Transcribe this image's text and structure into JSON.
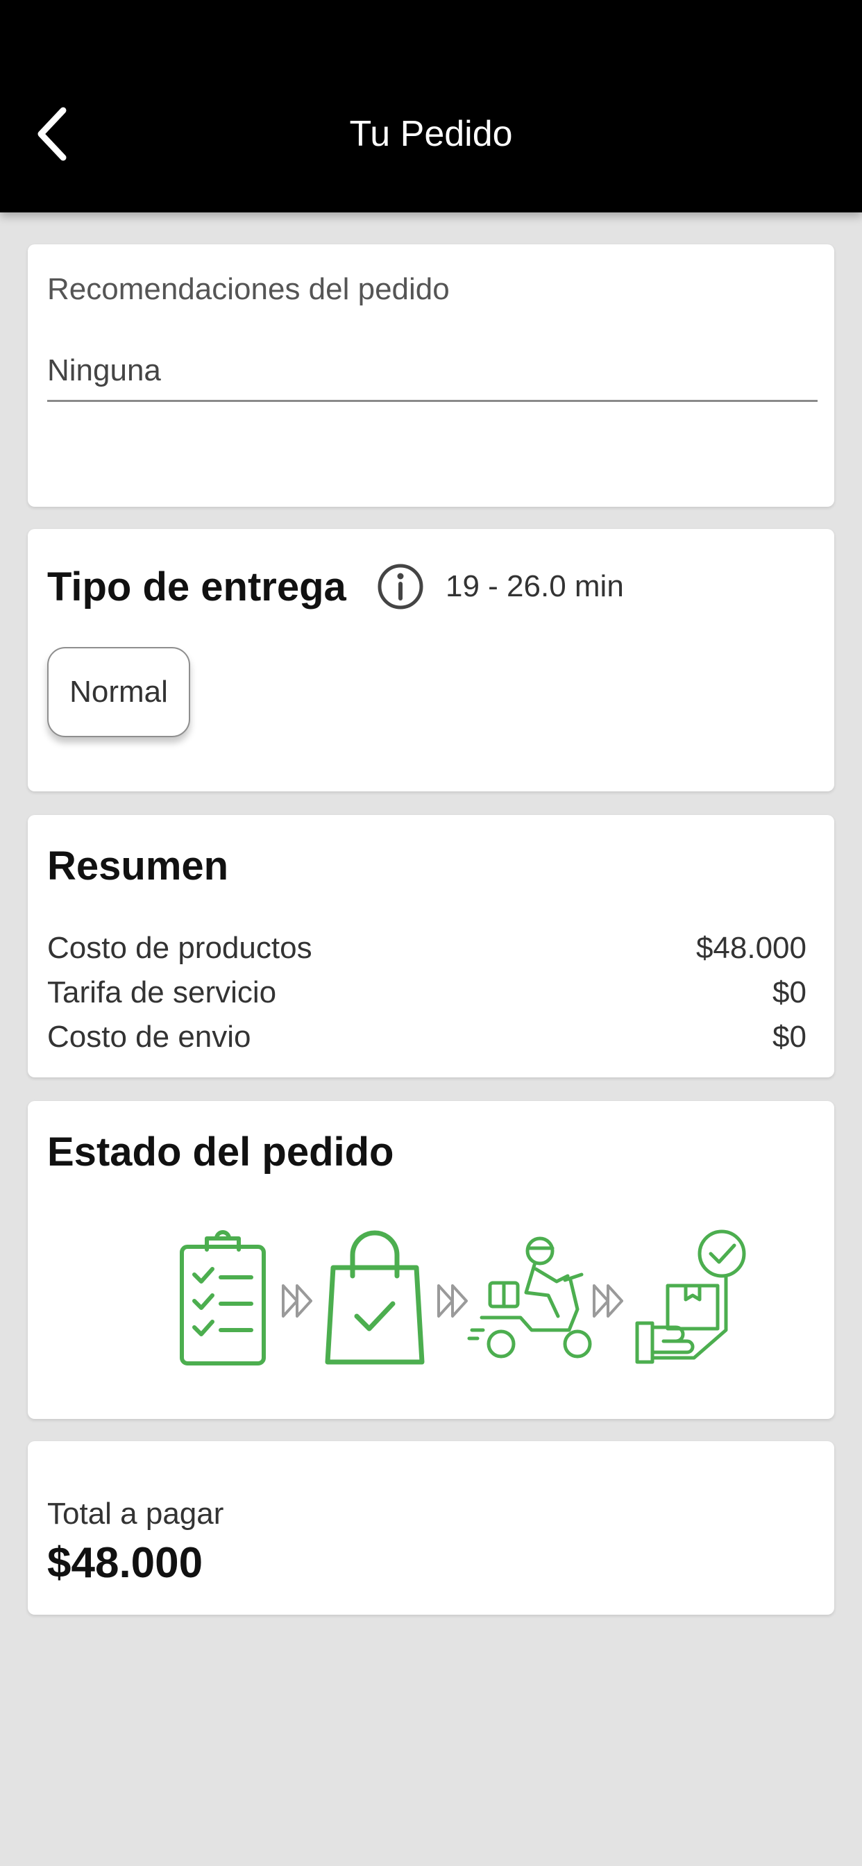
{
  "header": {
    "title": "Tu Pedido",
    "background": "#000000"
  },
  "recommendations": {
    "label": "Recomendaciones del pedido",
    "value": "Ninguna"
  },
  "delivery": {
    "title": "Tipo de entrega",
    "time": "19 - 26.0 min",
    "option": "Normal"
  },
  "summary": {
    "title": "Resumen",
    "rows": [
      {
        "label": "Costo de productos",
        "value": "$48.000"
      },
      {
        "label": "Tarifa de servicio",
        "value": "$0"
      },
      {
        "label": "Costo de envio",
        "value": "$0"
      }
    ]
  },
  "status": {
    "title": "Estado del pedido",
    "steps": [
      "clipboard-checklist-icon",
      "shopping-bag-check-icon",
      "delivery-scooter-icon",
      "package-received-icon"
    ],
    "accent": "#4cae4f"
  },
  "total": {
    "label": "Total a pagar",
    "value": "$48.000"
  }
}
